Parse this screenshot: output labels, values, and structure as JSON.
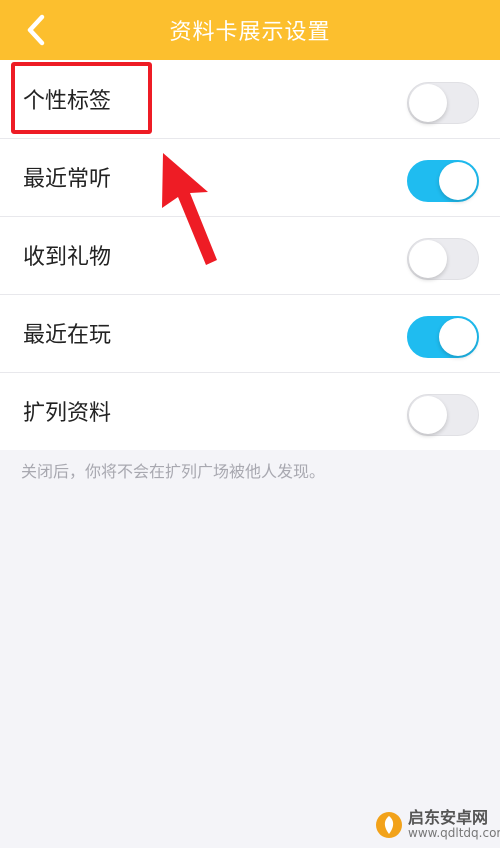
{
  "header": {
    "title": "资料卡展示设置",
    "background": "#fcbf2e",
    "back_icon": "chevron-left-icon"
  },
  "settings": [
    {
      "label": "个性标签",
      "enabled": false
    },
    {
      "label": "最近常听",
      "enabled": true
    },
    {
      "label": "收到礼物",
      "enabled": false
    },
    {
      "label": "最近在玩",
      "enabled": true
    },
    {
      "label": "扩列资料",
      "enabled": false
    }
  ],
  "hint": "关闭后，你将不会在扩列广场被他人发现。",
  "colors": {
    "toggle_on": "#1fbcf0",
    "toggle_off": "#ebebef",
    "annotation": "#ee1c25"
  },
  "watermark": {
    "name": "启东安卓网",
    "url": "www.qdltdq.com"
  }
}
